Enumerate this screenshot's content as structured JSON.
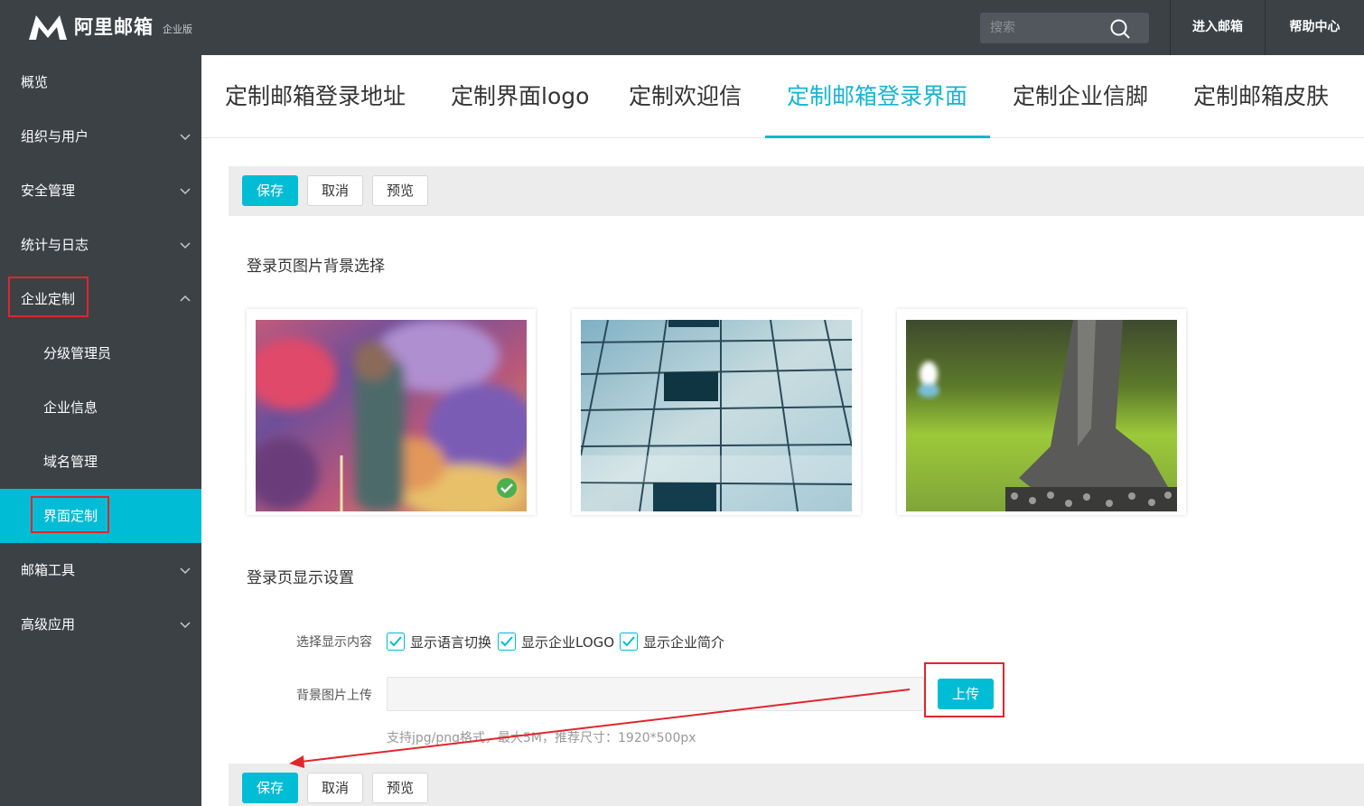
{
  "header": {
    "brand_name": "阿里邮箱",
    "edition": "企业版",
    "search_placeholder": "搜索",
    "enter_mailbox": "进入邮箱",
    "help_center": "帮助中心"
  },
  "sidebar": {
    "items": [
      {
        "label": "概览"
      },
      {
        "label": "组织与用户"
      },
      {
        "label": "安全管理"
      },
      {
        "label": "统计与日志"
      },
      {
        "label": "企业定制"
      },
      {
        "label": "分级管理员"
      },
      {
        "label": "企业信息"
      },
      {
        "label": "域名管理"
      },
      {
        "label": "界面定制"
      },
      {
        "label": "邮箱工具"
      },
      {
        "label": "高级应用"
      }
    ]
  },
  "tabs": [
    {
      "label": "定制邮箱登录地址"
    },
    {
      "label": "定制界面logo"
    },
    {
      "label": "定制欢迎信"
    },
    {
      "label": "定制邮箱登录界面"
    },
    {
      "label": "定制企业信脚"
    },
    {
      "label": "定制邮箱皮肤"
    }
  ],
  "toolbar": {
    "save": "保存",
    "cancel": "取消",
    "preview": "预览"
  },
  "background_section": {
    "title": "登录页图片背景选择",
    "selected_index": 0
  },
  "display_section": {
    "title": "登录页显示设置",
    "content_label": "选择显示内容",
    "options": [
      {
        "label": "显示语言切换",
        "checked": true
      },
      {
        "label": "显示企业LOGO",
        "checked": true
      },
      {
        "label": "显示企业简介",
        "checked": true
      }
    ],
    "upload_label": "背景图片上传",
    "upload_button": "上传",
    "upload_hint": "支持jpg/png格式，最大5M，推荐尺寸：1920*500px"
  },
  "colors": {
    "accent": "#00bcd4",
    "sidebar_bg": "#3c4146",
    "annotation_red": "#e0262d"
  }
}
